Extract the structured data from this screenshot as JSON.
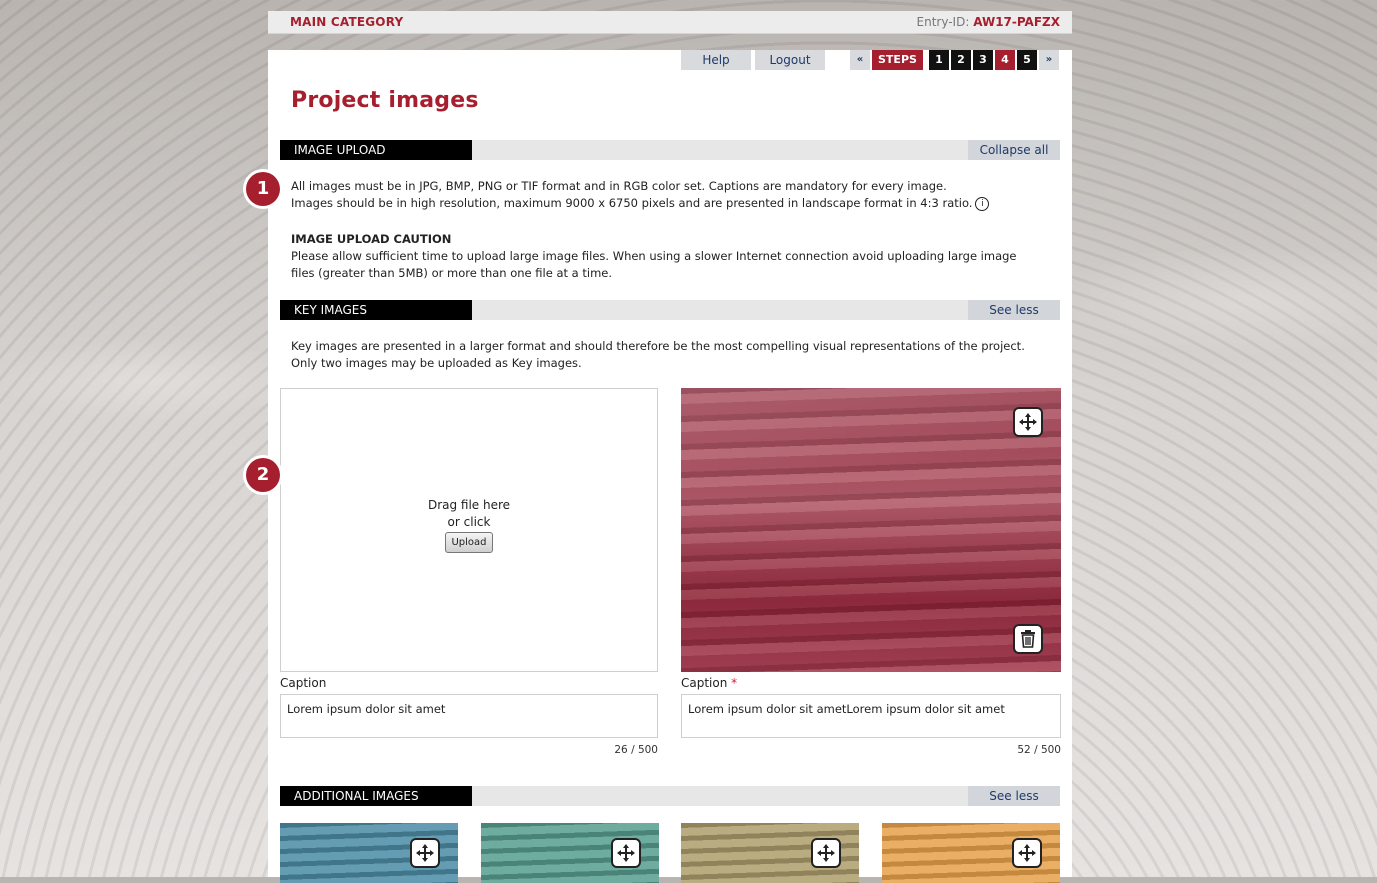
{
  "header": {
    "category": "MAIN CATEGORY",
    "entry_label": "Entry-ID:",
    "entry_id": "AW17-PAFZX"
  },
  "nav": {
    "help": "Help",
    "logout": "Logout",
    "prev": "«",
    "steps_label": "STEPS",
    "steps": [
      "1",
      "2",
      "3",
      "4",
      "5"
    ],
    "active_step": "4",
    "next": "»"
  },
  "page_title": "Project images",
  "image_upload": {
    "heading": "IMAGE UPLOAD",
    "action": "Collapse all",
    "line1": "All images must be in JPG, BMP, PNG or TIF format and in RGB color set. Captions are mandatory for every image.",
    "line2": "Images should be in high resolution, maximum 9000 x 6750 pixels and are presented in landscape format in 4:3 ratio.",
    "info_icon": "i",
    "caution_title": "IMAGE UPLOAD CAUTION",
    "caution_text": "Please allow sufficient time to upload large image files. When using a slower Internet connection avoid uploading large image files (greater than 5MB) or more than one file at a time."
  },
  "badges": [
    "1",
    "2"
  ],
  "key_images": {
    "heading": "KEY IMAGES",
    "action": "See less",
    "description": "Key images are presented in a larger format and should therefore be the most compelling visual representations of the project. Only two images may be uploaded as Key images.",
    "dropzone": {
      "line1": "Drag file here",
      "line2": "or click",
      "button": "Upload"
    },
    "items": [
      {
        "caption_label": "Caption",
        "required": "",
        "caption_value": "Lorem ipsum dolor sit amet",
        "counter": "26 / 500"
      },
      {
        "caption_label": "Caption",
        "required": "*",
        "caption_value": "Lorem ipsum dolor sit ametLorem ipsum dolor sit amet",
        "counter": "52 / 500"
      }
    ]
  },
  "additional_images": {
    "heading": "ADDITIONAL IMAGES",
    "action": "See less"
  },
  "colors": {
    "accent": "#a61f2e",
    "thumb1": "#4f90a8",
    "thumb2": "#5aa092",
    "thumb3": "#b0a070",
    "thumb4": "#e6a14a"
  },
  "icons": {
    "move": "move-icon",
    "delete": "trash-icon",
    "info": "info-icon"
  }
}
